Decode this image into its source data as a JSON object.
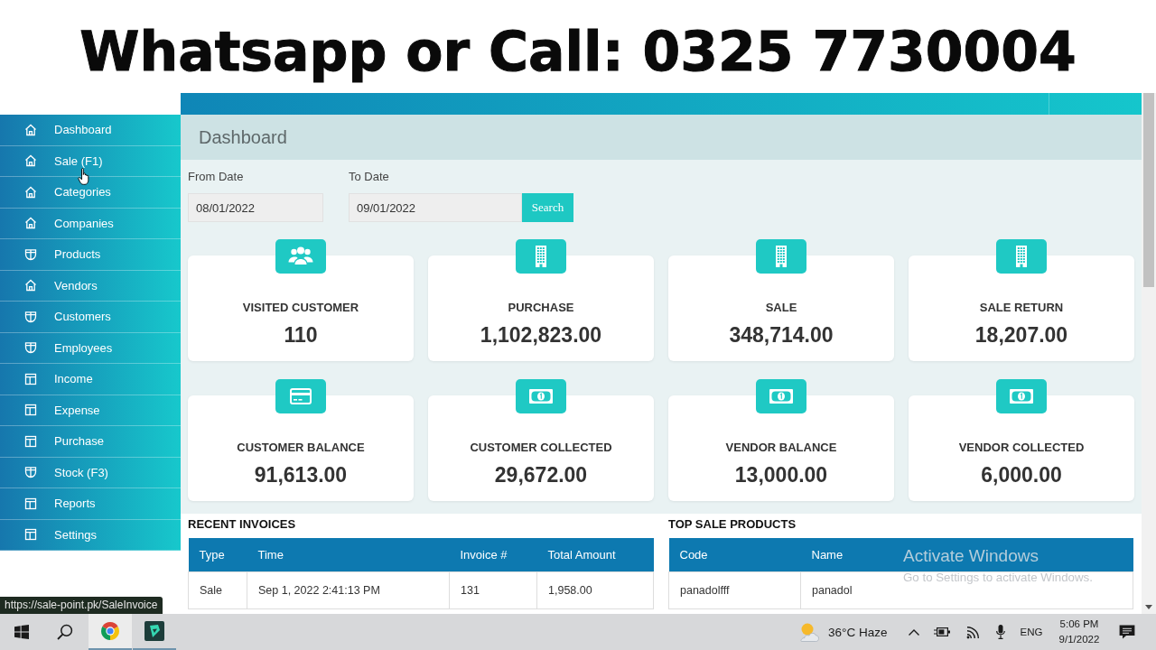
{
  "banner": {
    "text": "Whatsapp or Call: 0325 7730004"
  },
  "sidebar": {
    "items": [
      {
        "label": "Dashboard",
        "kind": "home"
      },
      {
        "label": "Sale (F1)",
        "kind": "home"
      },
      {
        "label": "Categories",
        "kind": "home"
      },
      {
        "label": "Companies",
        "kind": "home"
      },
      {
        "label": "Products",
        "kind": "shield"
      },
      {
        "label": "Vendors",
        "kind": "home"
      },
      {
        "label": "Customers",
        "kind": "shield"
      },
      {
        "label": "Employees",
        "kind": "shield"
      },
      {
        "label": "Income",
        "kind": "panel"
      },
      {
        "label": "Expense",
        "kind": "panel"
      },
      {
        "label": "Purchase",
        "kind": "panel"
      },
      {
        "label": "Stock (F3)",
        "kind": "shield"
      },
      {
        "label": "Reports",
        "kind": "panel"
      },
      {
        "label": "Settings",
        "kind": "panel"
      }
    ]
  },
  "page": {
    "title": "Dashboard"
  },
  "filters": {
    "from_date": {
      "label": "From Date",
      "value": "08/01/2022"
    },
    "to_date": {
      "label": "To Date",
      "value": "09/01/2022"
    },
    "search_button": "Search"
  },
  "stats": [
    {
      "kind": "users",
      "title": "VISITED CUSTOMER",
      "value": "110"
    },
    {
      "kind": "building",
      "title": "PURCHASE",
      "value": "1,102,823.00"
    },
    {
      "kind": "building",
      "title": "SALE",
      "value": "348,714.00"
    },
    {
      "kind": "building",
      "title": "SALE RETURN",
      "value": "18,207.00"
    },
    {
      "kind": "card",
      "title": "CUSTOMER BALANCE",
      "value": "91,613.00"
    },
    {
      "kind": "cash",
      "title": "CUSTOMER COLLECTED",
      "value": "29,672.00"
    },
    {
      "kind": "cash",
      "title": "VENDOR BALANCE",
      "value": "13,000.00"
    },
    {
      "kind": "cash",
      "title": "VENDOR COLLECTED",
      "value": "6,000.00"
    }
  ],
  "recent_invoices": {
    "title": "RECENT INVOICES",
    "columns": [
      "Type",
      "Time",
      "Invoice #",
      "Total Amount"
    ],
    "rows": [
      [
        "Sale",
        "Sep 1, 2022 2:41:13 PM",
        "131",
        "1,958.00"
      ]
    ]
  },
  "top_sale_products": {
    "title": "TOP SALE PRODUCTS",
    "columns": [
      "Code",
      "Name"
    ],
    "rows": [
      [
        "panadolfff",
        "panadol"
      ]
    ]
  },
  "activation_notice": {
    "title": "Activate Windows",
    "subtitle": "Go to Settings to activate Windows."
  },
  "status_url": "https://sale-point.pk/SaleInvoice",
  "taskbar": {
    "apps": [
      {
        "kind": "browser",
        "selected": true
      },
      {
        "kind": "video-editor",
        "selected": false
      }
    ],
    "weather": "36°C Haze",
    "language": "ENG",
    "time": "5:06 PM",
    "date": "9/1/2022"
  }
}
